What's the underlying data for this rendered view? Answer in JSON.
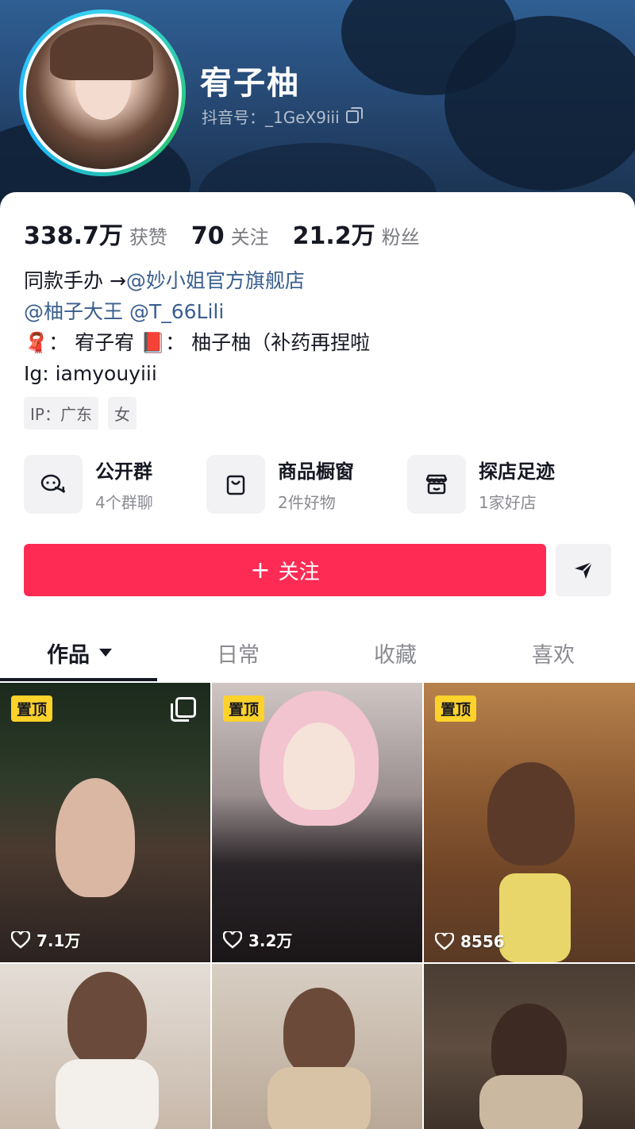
{
  "profile": {
    "nickname": "宥子柚",
    "douyin_id": "抖音号：_1GeX9iii"
  },
  "stats": [
    {
      "value": "338.7万",
      "label": "获赞"
    },
    {
      "value": "70",
      "label": "关注"
    },
    {
      "value": "21.2万",
      "label": "粉丝"
    }
  ],
  "bio": {
    "line1_text": "同款手办 →",
    "line1_link": "@妙小姐官方旗舰店",
    "line2_link1": "@柚子大王",
    "line2_link2": "@T_66Lili",
    "line3": "🧣： 宥子宥 📕： 柚子柚（补药再捏啦",
    "line4": "Ig: iamyouyiii"
  },
  "tags": [
    "IP：广东",
    "女"
  ],
  "entries": [
    {
      "title": "公开群",
      "sub": "4个群聊",
      "icon": "chat-bubbles-icon"
    },
    {
      "title": "商品橱窗",
      "sub": "2件好物",
      "icon": "shopping-bag-icon"
    },
    {
      "title": "探店足迹",
      "sub": "1家好店",
      "icon": "storefront-icon"
    }
  ],
  "actions": {
    "follow_label": "关注",
    "follow_plus": "+",
    "share_icon": "send-arrow-icon"
  },
  "tabs": [
    "作品",
    "日常",
    "收藏",
    "喜欢"
  ],
  "colors": {
    "accent": "#fe2c55",
    "pin": "#fdd22a",
    "link": "#3a5f8f"
  },
  "videos": [
    {
      "pinned": "置顶",
      "likes": "7.1万",
      "multi": true
    },
    {
      "pinned": "置顶",
      "likes": "3.2万"
    },
    {
      "pinned": "置顶",
      "likes": "8556"
    },
    {},
    {},
    {}
  ]
}
